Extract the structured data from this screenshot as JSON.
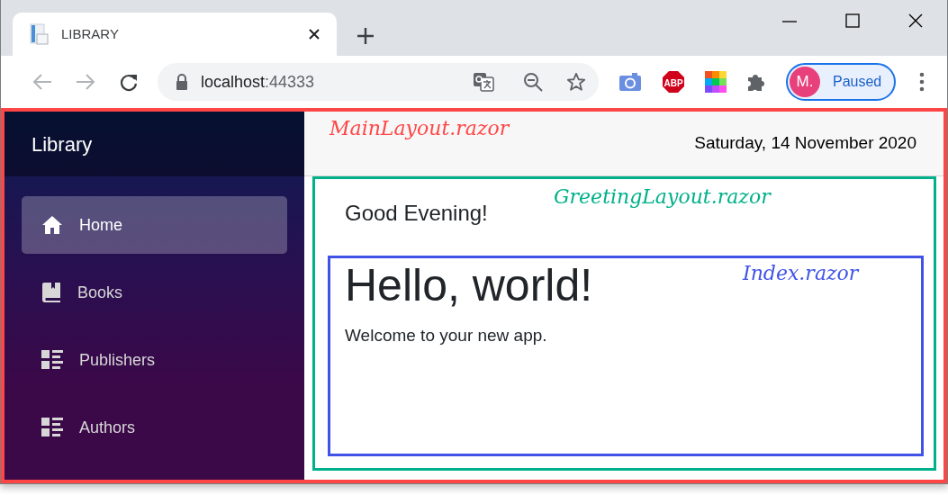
{
  "browser": {
    "tab": {
      "title": "LIBRARY"
    },
    "url_host": "localhost",
    "url_port": ":44333",
    "adblock_label": "ABP",
    "profile": {
      "initial": "M.",
      "status": "Paused"
    }
  },
  "sidebar": {
    "brand": "Library",
    "items": [
      {
        "label": "Home",
        "kind": "home",
        "selected": true
      },
      {
        "label": "Books",
        "kind": "book",
        "selected": false
      },
      {
        "label": "Publishers",
        "kind": "list",
        "selected": false
      },
      {
        "label": "Authors",
        "kind": "list",
        "selected": false
      }
    ]
  },
  "main_layout": {
    "label": "MainLayout.razor",
    "color": "#ff4646",
    "date": "Saturday, 14 November 2020"
  },
  "greeting_layout": {
    "label": "GreetingLayout.razor",
    "color": "#00b08a",
    "greeting": "Good Evening!"
  },
  "index_page": {
    "label": "Index.razor",
    "color": "#4053e6",
    "heading": "Hello, world!",
    "text": "Welcome to your new app."
  }
}
